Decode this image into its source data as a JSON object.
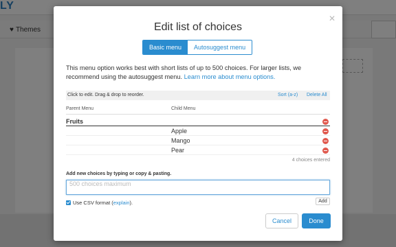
{
  "background": {
    "logo": "LY",
    "themes_label": "Themes"
  },
  "modal": {
    "title": "Edit list of choices",
    "tabs": [
      {
        "label": "Basic menu",
        "active": true
      },
      {
        "label": "Autosuggest menu",
        "active": false
      }
    ],
    "intro_text": "This menu option works best with short lists of up to 500 choices. For larger lists, we recommend using the autosuggest menu.",
    "intro_link": "Learn more about menu options.",
    "list_header": {
      "hint": "Click to edit. Drag & drop to reorder.",
      "sort": "Sort (a-z)",
      "delete_all": "Delete All"
    },
    "columns": {
      "parent": "Parent Menu",
      "child": "Child Menu"
    },
    "rows": [
      {
        "parent": "Fruits",
        "child": ""
      },
      {
        "parent": "",
        "child": "Apple"
      },
      {
        "parent": "",
        "child": "Mango"
      },
      {
        "parent": "",
        "child": "Pear"
      }
    ],
    "count_text": "4 choices entered",
    "add_label": "Add new choices by typing or copy & pasting.",
    "input_placeholder": "500 choices maximum",
    "csv_label_prefix": "Use CSV format (",
    "csv_link": "explain",
    "csv_label_suffix": ").",
    "add_button": "Add",
    "cancel_button": "Cancel",
    "done_button": "Done"
  },
  "colors": {
    "accent": "#2a8ccf",
    "delete": "#e05a4f"
  }
}
